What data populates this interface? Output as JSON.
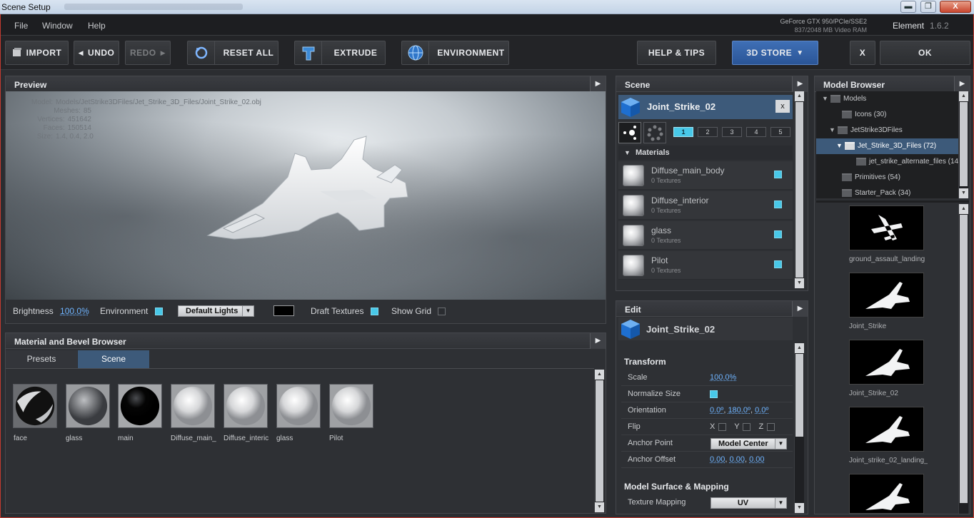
{
  "window": {
    "title": "Scene Setup",
    "btn_min": "▬",
    "btn_max": "❐",
    "btn_close": "X"
  },
  "menu": {
    "file": "File",
    "window": "Window",
    "help": "Help"
  },
  "gpu": {
    "name": "GeForce GTX 950/PCIe/SSE2",
    "vram": "837/2048 MB Video RAM"
  },
  "product": {
    "name": "Element",
    "version": "1.6.2"
  },
  "toolbar": {
    "import": "IMPORT",
    "undo": "UNDO",
    "redo": "REDO",
    "reset_all": "RESET ALL",
    "extrude": "EXTRUDE",
    "environment": "ENVIRONMENT",
    "help_tips": "HELP & TIPS",
    "store": "3D STORE",
    "close": "X",
    "ok": "OK"
  },
  "preview": {
    "title": "Preview",
    "stats": [
      {
        "k": "Model:",
        "v": "Models/JetStrike3DFiles/Jet_Strike_3D_Files/Joint_Strike_02.obj"
      },
      {
        "k": "Meshes:",
        "v": "85"
      },
      {
        "k": "Vertices:",
        "v": "451642"
      },
      {
        "k": "Faces:",
        "v": "150514"
      },
      {
        "k": "Size:",
        "v": "1.4, 0.4, 2.0"
      }
    ],
    "brightness_label": "Brightness",
    "brightness_value": "100.0%",
    "environment_label": "Environment",
    "lights": "Default Lights",
    "draft_label": "Draft Textures",
    "grid_label": "Show Grid"
  },
  "matbrowser": {
    "title": "Material and Bevel Browser",
    "tabs": [
      "Presets",
      "Scene"
    ],
    "items": [
      "face",
      "glass",
      "main",
      "Diffuse_main_",
      "Diffuse_interic",
      "glass",
      "Pilot"
    ]
  },
  "scene": {
    "title": "Scene",
    "object": "Joint_Strike_02",
    "close": "x",
    "layers": [
      "1",
      "2",
      "3",
      "4",
      "5"
    ],
    "materials_label": "Materials",
    "materials": [
      {
        "name": "Diffuse_main_body",
        "sub": "0 Textures"
      },
      {
        "name": "Diffuse_interior",
        "sub": "0 Textures"
      },
      {
        "name": "glass",
        "sub": "0 Textures"
      },
      {
        "name": "Pilot",
        "sub": "0 Textures"
      }
    ]
  },
  "edit": {
    "title": "Edit",
    "object": "Joint_Strike_02",
    "transform": "Transform",
    "scale_k": "Scale",
    "scale_v": "100.0%",
    "normalize_k": "Normalize Size",
    "orient_k": "Orientation",
    "orient_a": "0.0º",
    "orient_b": "180.0º",
    "orient_c": "0.0º",
    "flip_k": "Flip",
    "fx": "X",
    "fy": "Y",
    "fz": "Z",
    "anchor_k": "Anchor Point",
    "anchor_v": "Model Center",
    "offset_k": "Anchor Offset",
    "off_a": "0.00",
    "off_b": "0.00",
    "off_c": "0.00",
    "surface": "Model Surface & Mapping",
    "mapping_k": "Texture Mapping",
    "mapping_v": "UV"
  },
  "modelbrowser": {
    "title": "Model Browser",
    "tree": [
      {
        "label": "Models"
      },
      {
        "label": "Icons (30)"
      },
      {
        "label": "JetStrike3DFiles"
      },
      {
        "label": "Jet_Strike_3D_Files (72)"
      },
      {
        "label": "jet_strike_alternate_files (14"
      },
      {
        "label": "Primitives (54)"
      },
      {
        "label": "Starter_Pack (34)"
      }
    ],
    "thumbs": [
      "ground_assault_landing",
      "Joint_Strike",
      "Joint_Strike_02",
      "Joint_strike_02_landing_"
    ]
  },
  "colors": {
    "accent": "#48c8e8",
    "selection": "#3d5a7a",
    "store": "#2a5597",
    "link": "#6fb4ff"
  }
}
